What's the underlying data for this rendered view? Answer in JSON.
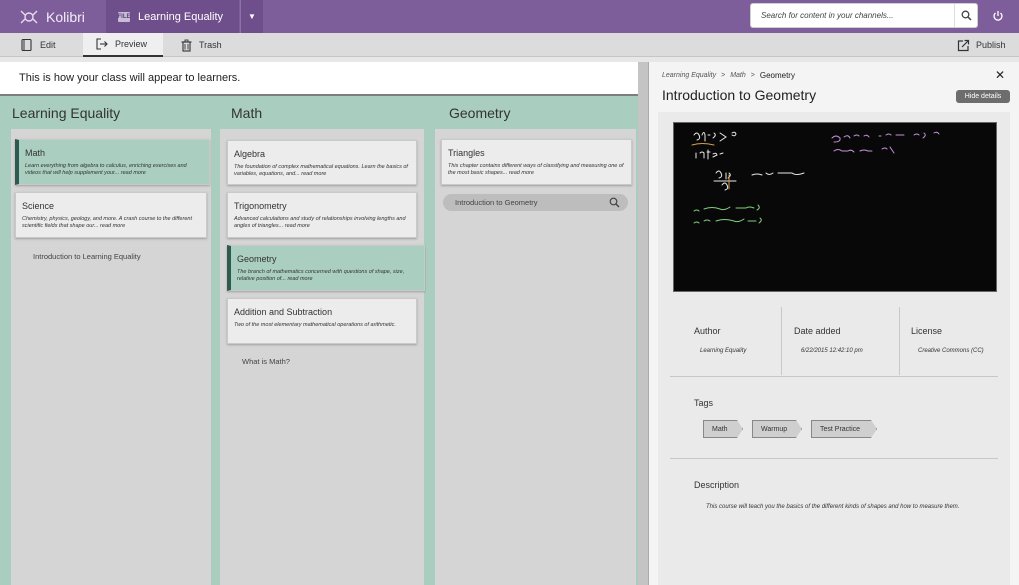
{
  "app": {
    "name": "Kolibri"
  },
  "channel": {
    "badge": "FILE",
    "name": "Learning Equality"
  },
  "search": {
    "placeholder": "Search for content in your channels..."
  },
  "toolbar": {
    "edit": "Edit",
    "preview": "Preview",
    "trash": "Trash",
    "publish": "Publish"
  },
  "banner": "This is how your class will appear to learners.",
  "columns": [
    {
      "title": "Learning Equality",
      "cards": [
        {
          "title": "Math",
          "desc": "Learn everything from algebra to calculus, enriching exercises and videos that will help supplement your... read more",
          "active": true
        },
        {
          "title": "Science",
          "desc": "Chemistry, physics, geology, and more. A crash course to the different scientific fields that shape our... read more",
          "active": false
        }
      ],
      "items": [
        "Introduction to Learning Equality"
      ]
    },
    {
      "title": "Math",
      "cards": [
        {
          "title": "Algebra",
          "desc": "The foundation of complex mathematical equations. Learn the basics of variables, equations, and... read more",
          "active": false
        },
        {
          "title": "Trigonometry",
          "desc": "Advanced calculations and study of relationships involving lengths and angles of triangles... read more",
          "active": false
        },
        {
          "title": "Geometry",
          "desc": "The branch of mathematics concerned with questions of shape, size, relative position of... read more",
          "active": true
        },
        {
          "title": "Addition and Subtraction",
          "desc": "Two of the most elementary mathematical operations of arithmetic.",
          "active": false
        }
      ],
      "items": [
        "What is Math?"
      ]
    },
    {
      "title": "Geometry",
      "cards": [
        {
          "title": "Triangles",
          "desc": "This chapter contains different ways of classifying and measuring one of the most basic shapes... read more",
          "active": false
        }
      ],
      "items": [
        "Introduction to Geometry"
      ]
    }
  ],
  "details": {
    "breadcrumb": [
      "Learning Equality",
      "Math",
      "Geometry"
    ],
    "title": "Introduction to Geometry",
    "hide_label": "Hide details",
    "author_label": "Author",
    "author": "Learning Equality",
    "date_label": "Date added",
    "date": "6/22/2015 12:42:10 pm",
    "license_label": "License",
    "license": "Creative Commons (CC)",
    "tags_label": "Tags",
    "tags": [
      "Math",
      "Warmup",
      "Test Practice"
    ],
    "description_label": "Description",
    "description": "This course will teach you the basics of the different kinds of shapes and how to measure them."
  },
  "colors": {
    "topbar": "#7e5e9a",
    "column": "#a9cebf",
    "active_card": "#aacfc0",
    "active_bar": "#2f5a4f"
  },
  "icons": [
    "kolibri-logo-icon",
    "search-icon",
    "power-icon",
    "edit-icon",
    "preview-icon",
    "trash-icon",
    "publish-icon",
    "close-icon",
    "chevron-down-icon"
  ]
}
